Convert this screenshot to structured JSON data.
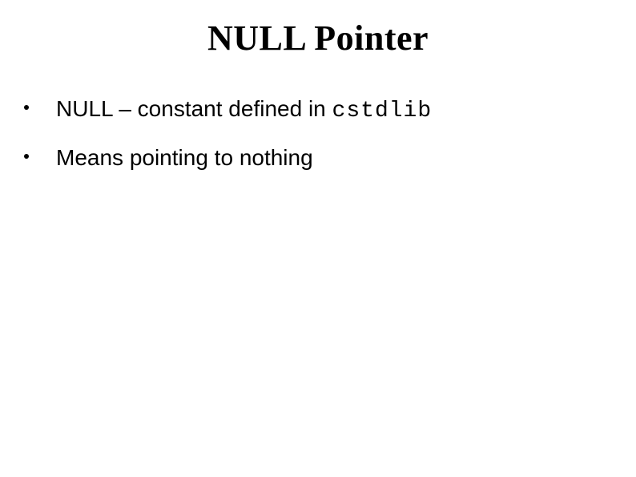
{
  "slide": {
    "title": "NULL Pointer",
    "bullets": [
      {
        "prefix": "NULL – constant defined in ",
        "code": "cstdlib"
      },
      {
        "text": "Means pointing to nothing"
      }
    ]
  }
}
